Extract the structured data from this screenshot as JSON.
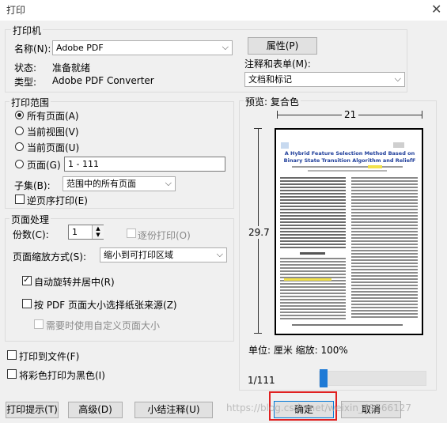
{
  "window": {
    "title": "打印"
  },
  "printer": {
    "group_label": "打印机",
    "name_label": "名称(N):",
    "name_value": "Adobe PDF",
    "properties_button": "属性(P)",
    "status_label": "状态:",
    "status_value": "准备就绪",
    "type_label": "类型:",
    "type_value": "Adobe PDF Converter",
    "comments_label": "注释和表单(M):",
    "comments_value": "文档和标记"
  },
  "range": {
    "group_label": "打印范围",
    "all_pages": "所有页面(A)",
    "current_view": "当前视图(V)",
    "current_page": "当前页面(U)",
    "pages": "页面(G)",
    "pages_value": "1 - 111",
    "subset_label": "子集(B):",
    "subset_value": "范围中的所有页面",
    "reverse": "逆页序打印(E)"
  },
  "handling": {
    "group_label": "页面处理",
    "copies_label": "份数(C):",
    "copies_value": "1",
    "collate": "逐份打印(O)",
    "scaling_label": "页面缩放方式(S):",
    "scaling_value": "缩小到可打印区域",
    "auto_rotate": "自动旋转并居中(R)",
    "choose_paper": "按 PDF 页面大小选择纸张来源(Z)",
    "custom_size": "需要时使用自定义页面大小"
  },
  "output": {
    "print_to_file": "打印到文件(F)",
    "print_black": "将彩色打印为黑色(I)"
  },
  "preview": {
    "label": "预览: 复合色",
    "width": "21",
    "height": "29.7",
    "units": "单位: 厘米 缩放: 100%",
    "page_indicator": "1/111",
    "paper_title_line1": "A Hybrid Feature Selection Method Based on",
    "paper_title_line2": "Binary State Transition Algorithm and ReliefF",
    "slider_position": 0.0
  },
  "buttons": {
    "print_tips": "打印提示(T)",
    "advanced": "高级(D)",
    "summarize": "小结注释(U)",
    "ok": "确定",
    "cancel": "取消"
  },
  "watermark": "https://blog.csdn.net/weixin_41566127",
  "colors": {
    "highlight_border": "#e02020",
    "slider_thumb": "#1e7ad6"
  }
}
